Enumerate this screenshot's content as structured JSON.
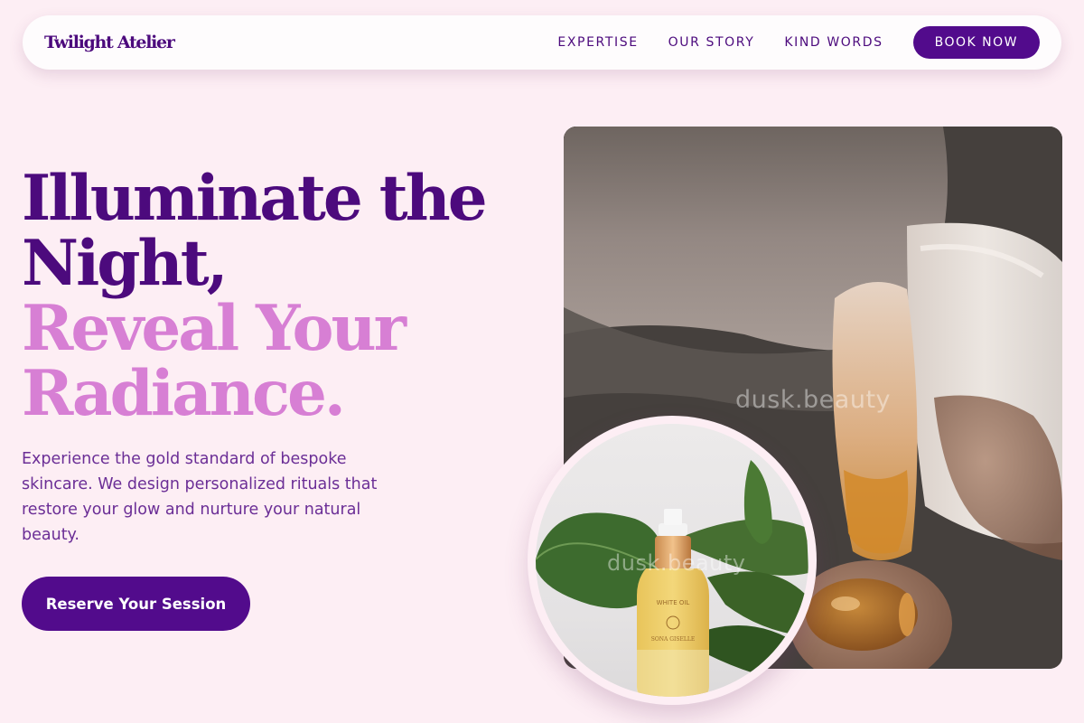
{
  "brand": {
    "name": "Twilight Atelier"
  },
  "nav": {
    "links": [
      "EXPERTISE",
      "OUR STORY",
      "KIND WORDS"
    ],
    "cta": "BOOK NOW"
  },
  "hero": {
    "line1": "Illuminate the",
    "line2": "Night,",
    "line3": "Reveal Your",
    "line4": "Radiance.",
    "description": "Experience the gold standard of bespoke skincare. We design personalized rituals that restore your glow and nurture your natural beauty.",
    "cta": "Reserve Your Session"
  },
  "images": {
    "watermark": "dusk.beauty",
    "bottle_label_1": "WHITE OIL",
    "bottle_label_2": "SONA GISELLE"
  },
  "colors": {
    "primary": "#4c0a7d",
    "button": "#520b8c",
    "accent": "#d77fd4",
    "background": "#fdeef4"
  }
}
